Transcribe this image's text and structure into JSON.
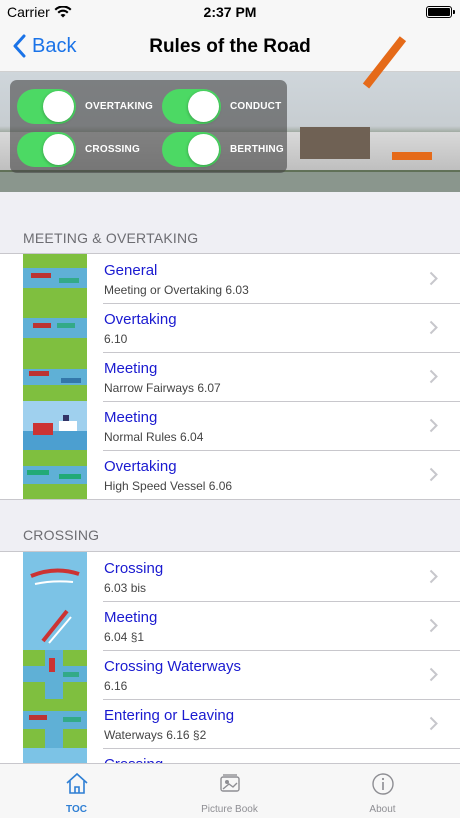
{
  "status": {
    "carrier": "Carrier",
    "time": "2:37 PM"
  },
  "nav": {
    "back_label": "Back",
    "title": "Rules of the Road"
  },
  "toggles": [
    {
      "label": "OVERTAKING",
      "on": true
    },
    {
      "label": "CONDUCT",
      "on": true
    },
    {
      "label": "CROSSING",
      "on": true
    },
    {
      "label": "BERTHING",
      "on": true
    }
  ],
  "sections": [
    {
      "title": "MEETING & OVERTAKING",
      "rows": [
        {
          "title": "General",
          "subtitle": "Meeting or Overtaking 6.03"
        },
        {
          "title": "Overtaking",
          "subtitle": "6.10"
        },
        {
          "title": "Meeting",
          "subtitle": "Narrow Fairways 6.07"
        },
        {
          "title": "Meeting",
          "subtitle": "Normal Rules 6.04"
        },
        {
          "title": "Overtaking",
          "subtitle": "High Speed Vessel 6.06"
        }
      ]
    },
    {
      "title": "CROSSING",
      "rows": [
        {
          "title": "Crossing",
          "subtitle": "6.03 bis"
        },
        {
          "title": "Meeting",
          "subtitle": "6.04 §1"
        },
        {
          "title": "Crossing Waterways",
          "subtitle": "6.16"
        },
        {
          "title": "Entering or Leaving",
          "subtitle": "Waterways 6.16 §2"
        },
        {
          "title": "Crossing",
          "subtitle": ""
        }
      ]
    }
  ],
  "tabs": [
    {
      "label": "TOC",
      "icon": "home-icon",
      "active": true
    },
    {
      "label": "Picture Book",
      "icon": "picture-book-icon",
      "active": false
    },
    {
      "label": "About",
      "icon": "info-icon",
      "active": false
    }
  ],
  "colors": {
    "accent": "#1a73e8",
    "switch_on": "#4cd964",
    "row_title": "#1a1ad0",
    "tab_active": "#2f7fd4"
  }
}
